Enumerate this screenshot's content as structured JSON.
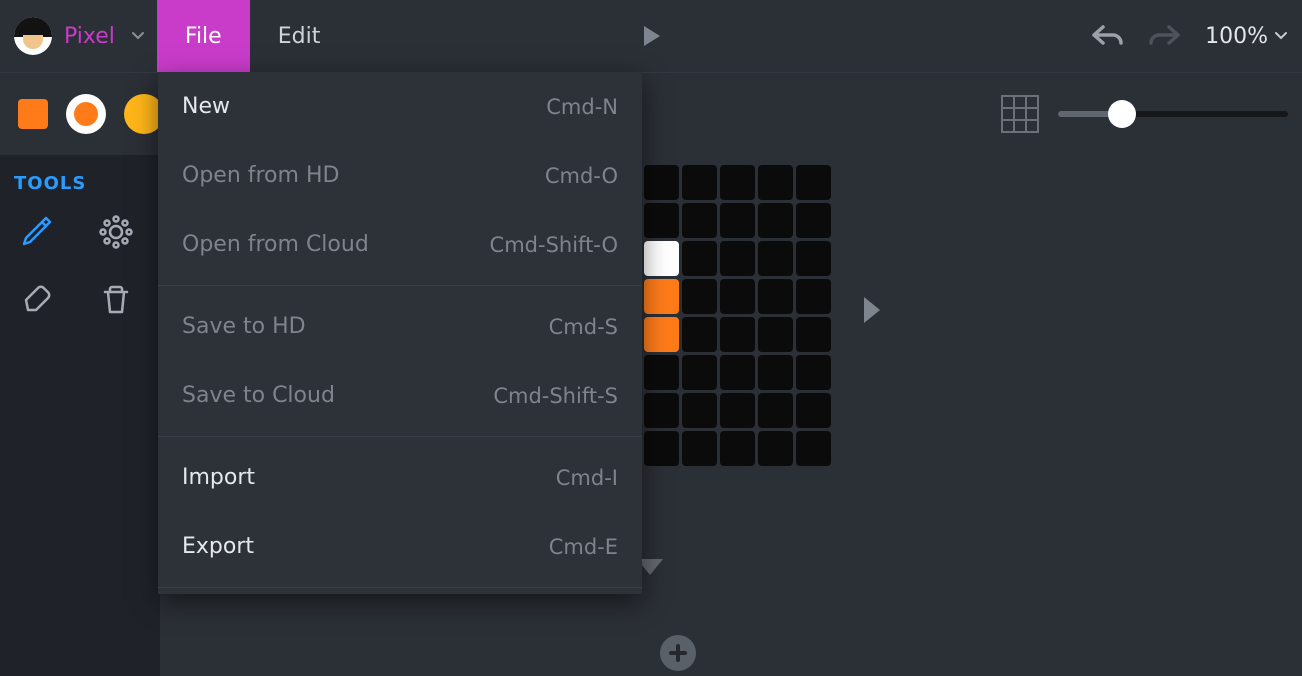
{
  "header": {
    "mode_label": "Pixel",
    "menu": {
      "file": "File",
      "edit": "Edit"
    },
    "zoom": "100%"
  },
  "file_menu": {
    "items": [
      {
        "label": "New",
        "shortcut": "Cmd-N",
        "enabled": true
      },
      {
        "label": "Open from HD",
        "shortcut": "Cmd-O",
        "enabled": false
      },
      {
        "label": "Open from Cloud",
        "shortcut": "Cmd-Shift-O",
        "enabled": false
      },
      {
        "label": "Save to HD",
        "shortcut": "Cmd-S",
        "enabled": false
      },
      {
        "label": "Save to Cloud",
        "shortcut": "Cmd-Shift-S",
        "enabled": false
      },
      {
        "label": "Import",
        "shortcut": "Cmd-I",
        "enabled": true
      },
      {
        "label": "Export",
        "shortcut": "Cmd-E",
        "enabled": true
      }
    ],
    "separators_after": [
      2,
      4,
      6
    ]
  },
  "palette": {
    "swatch_square_color": "#ff7b1a",
    "swatch_ring_inner_color": "#ff7b1a",
    "swatch_circle_color": "#ffb619",
    "slider_percent": 28
  },
  "sidebar": {
    "title": "TOOLS",
    "tools": [
      "pencil",
      "gear",
      "eraser",
      "trash"
    ]
  },
  "canvas": {
    "cols": 8,
    "rows": 8,
    "cells": [
      [
        ".",
        ".",
        ".",
        ".",
        ".",
        ".",
        ".",
        "."
      ],
      [
        ".",
        "w",
        "w",
        ".",
        ".",
        ".",
        ".",
        "."
      ],
      [
        ".",
        ".",
        "a",
        "w",
        ".",
        ".",
        ".",
        "."
      ],
      [
        ".",
        ".",
        ".",
        "o",
        ".",
        ".",
        ".",
        "."
      ],
      [
        ".",
        ".",
        "a",
        "o",
        ".",
        ".",
        ".",
        "."
      ],
      [
        ".",
        "w",
        "w",
        ".",
        ".",
        ".",
        ".",
        "."
      ],
      [
        ".",
        "w",
        ".",
        ".",
        ".",
        ".",
        ".",
        "."
      ],
      [
        "w",
        "w",
        ".",
        ".",
        ".",
        ".",
        ".",
        "."
      ]
    ],
    "legend": {
      "w": "#ffffff",
      "o": "#ff7b1a",
      "a": "#ffb619",
      ".": "#0b0b0b"
    }
  }
}
